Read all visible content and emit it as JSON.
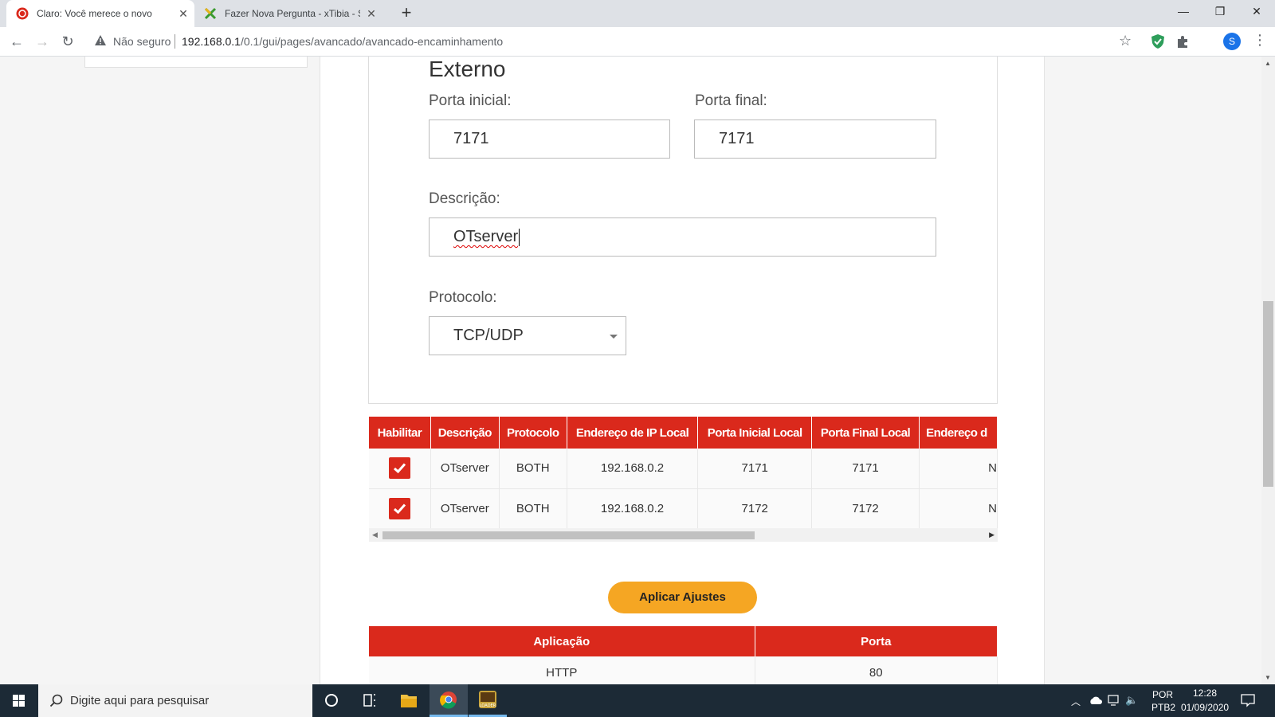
{
  "browser": {
    "tabs": [
      {
        "title": "Claro: Você merece o novo",
        "active": true
      },
      {
        "title": "Fazer Nova Pergunta - xTibia - Su",
        "active": false
      }
    ],
    "security_label": "Não seguro",
    "url_host": "192.168.0.1",
    "url_path": "/0.1/gui/pages/avancado/avancado-encaminhamento",
    "profile_initial": "S"
  },
  "form": {
    "section_title": "Externo",
    "start_port_label": "Porta inicial:",
    "start_port_value": "7171",
    "end_port_label": "Porta final:",
    "end_port_value": "7171",
    "description_label": "Descrição:",
    "description_value": "OTserver",
    "protocol_label": "Protocolo:",
    "protocol_value": "TCP/UDP"
  },
  "forward_table": {
    "headers": [
      "Habilitar",
      "Descrição",
      "Protocolo",
      "Endereço de IP Local",
      "Porta Inicial Local",
      "Porta Final Local",
      "Endereço d"
    ],
    "rows": [
      {
        "enabled": true,
        "description": "OTserver",
        "protocol": "BOTH",
        "local_ip": "192.168.0.2",
        "start_port": "7171",
        "end_port": "7171",
        "extra": "N"
      },
      {
        "enabled": true,
        "description": "OTserver",
        "protocol": "BOTH",
        "local_ip": "192.168.0.2",
        "start_port": "7172",
        "end_port": "7172",
        "extra": "N"
      }
    ]
  },
  "apply_button": "Aplicar Ajustes",
  "apps_table": {
    "headers": [
      "Aplicação",
      "Porta"
    ],
    "rows": [
      {
        "app": "HTTP",
        "port": "80"
      }
    ]
  },
  "taskbar": {
    "search_placeholder": "Digite aqui para pesquisar",
    "lang_top": "POR",
    "lang_bottom": "PTB2",
    "time": "12:28",
    "date": "01/09/2020"
  },
  "colors": {
    "brand_red": "#da291c",
    "accent_orange": "#f5a623"
  }
}
